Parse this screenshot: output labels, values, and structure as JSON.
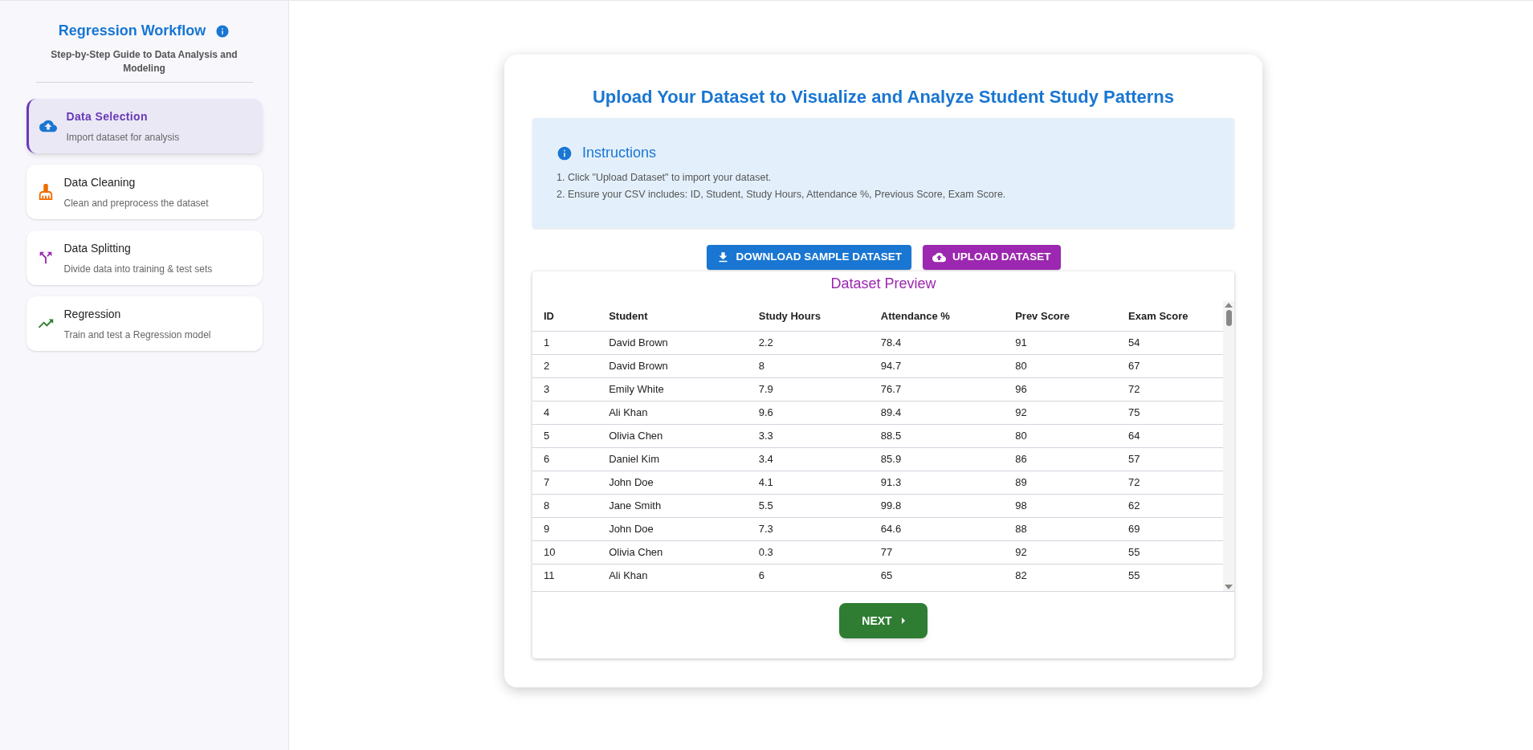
{
  "sidebar": {
    "title": "Regression Workflow",
    "subtitle": "Step-by-Step Guide to Data Analysis and Modeling",
    "steps": [
      {
        "kind": "upload",
        "label": "Data Selection",
        "description": "Import dataset for analysis",
        "selected": true
      },
      {
        "kind": "cleaning",
        "label": "Data Cleaning",
        "description": "Clean and preprocess the dataset",
        "selected": false
      },
      {
        "kind": "split",
        "label": "Data Splitting",
        "description": "Divide data into training & test sets",
        "selected": false
      },
      {
        "kind": "trend",
        "label": "Regression",
        "description": "Train and test a Regression model",
        "selected": false
      }
    ]
  },
  "main": {
    "title": "Upload Your Dataset to Visualize and Analyze Student Study Patterns",
    "instructions": {
      "title": "Instructions",
      "lines": [
        "1. Click \"Upload Dataset\" to import your dataset.",
        "2. Ensure your CSV includes: ID, Student, Study Hours, Attendance %, Previous Score, Exam Score."
      ]
    },
    "buttons": [
      {
        "kind": "download",
        "label": "DOWNLOAD SAMPLE DATASET"
      },
      {
        "kind": "upload",
        "label": "UPLOAD DATASET"
      }
    ],
    "preview": {
      "title": "Dataset Preview",
      "columns": [
        "ID",
        "Student",
        "Study Hours",
        "Attendance %",
        "Prev Score",
        "Exam Score"
      ],
      "rows": [
        [
          "1",
          "David Brown",
          "2.2",
          "78.4",
          "91",
          "54"
        ],
        [
          "2",
          "David Brown",
          "8",
          "94.7",
          "80",
          "67"
        ],
        [
          "3",
          "Emily White",
          "7.9",
          "76.7",
          "96",
          "72"
        ],
        [
          "4",
          "Ali Khan",
          "9.6",
          "89.4",
          "92",
          "75"
        ],
        [
          "5",
          "Olivia Chen",
          "3.3",
          "88.5",
          "80",
          "64"
        ],
        [
          "6",
          "Daniel Kim",
          "3.4",
          "85.9",
          "86",
          "57"
        ],
        [
          "7",
          "John Doe",
          "4.1",
          "91.3",
          "89",
          "72"
        ],
        [
          "8",
          "Jane Smith",
          "5.5",
          "99.8",
          "98",
          "62"
        ],
        [
          "9",
          "John Doe",
          "7.3",
          "64.6",
          "88",
          "69"
        ],
        [
          "10",
          "Olivia Chen",
          "0.3",
          "77",
          "92",
          "55"
        ],
        [
          "11",
          "Ali Khan",
          "6",
          "65",
          "82",
          "55"
        ]
      ]
    },
    "next_button": "NEXT"
  }
}
